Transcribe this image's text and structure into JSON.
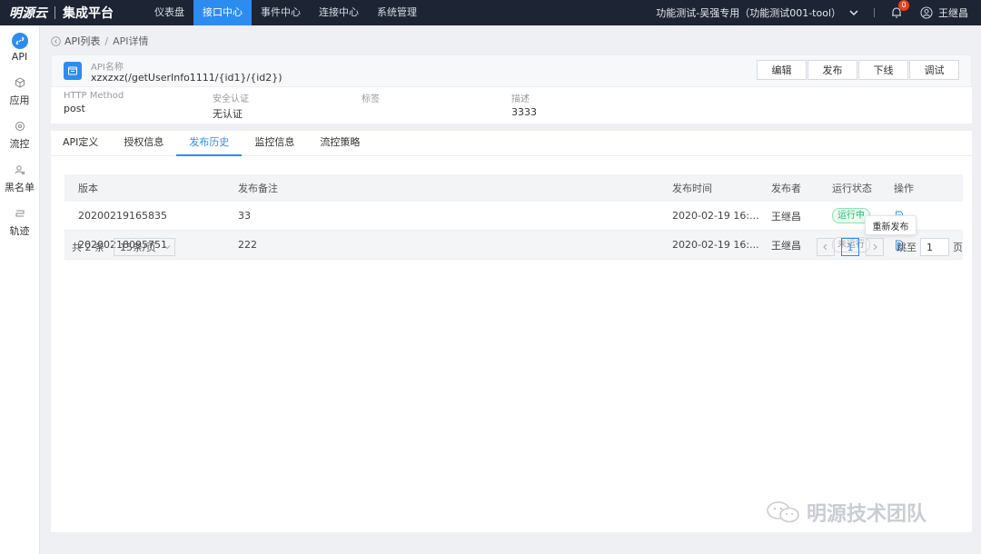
{
  "brand": {
    "logo": "明源云",
    "platform": "集成平台"
  },
  "nav": [
    {
      "label": "仪表盘",
      "active": false
    },
    {
      "label": "接口中心",
      "active": true
    },
    {
      "label": "事件中心",
      "active": false
    },
    {
      "label": "连接中心",
      "active": false
    },
    {
      "label": "系统管理",
      "active": false
    }
  ],
  "top_right": {
    "env": "功能测试-吴强专用（功能测试001-tool）",
    "badge": "0",
    "user": "王继昌"
  },
  "sidebar": [
    {
      "label": "API",
      "icon": "link-icon",
      "active": true
    },
    {
      "label": "应用",
      "icon": "cube-icon",
      "active": false
    },
    {
      "label": "流控",
      "icon": "flow-icon",
      "active": false
    },
    {
      "label": "黑名单",
      "icon": "blacklist-icon",
      "active": false
    },
    {
      "label": "轨迹",
      "icon": "trace-icon",
      "active": false
    }
  ],
  "breadcrumb": {
    "parent": "API列表",
    "separator": "/",
    "current": "API详情"
  },
  "api": {
    "name_label": "API名称",
    "name_value": "xzxzxz(/getUserInfo1111/{id1}/{id2})"
  },
  "actions": {
    "edit": "编辑",
    "publish": "发布",
    "offline": "下线",
    "debug": "调试"
  },
  "meta": {
    "method_label": "HTTP Method",
    "method_value": "post",
    "auth_label": "安全认证",
    "auth_value": "无认证",
    "tag_label": "标签",
    "tag_value": "",
    "desc_label": "描述",
    "desc_value": "3333"
  },
  "tabs": [
    {
      "label": "API定义",
      "active": false
    },
    {
      "label": "授权信息",
      "active": false
    },
    {
      "label": "发布历史",
      "active": true
    },
    {
      "label": "监控信息",
      "active": false
    },
    {
      "label": "流控策略",
      "active": false
    }
  ],
  "table": {
    "headers": {
      "version": "版本",
      "note": "发布备注",
      "time": "发布时间",
      "publisher": "发布者",
      "status": "运行状态",
      "op": "操作"
    },
    "rows": [
      {
        "version": "20200219165835",
        "note": "33",
        "time": "2020-02-19 16:...",
        "publisher": "王继昌",
        "status": "运行中",
        "status_type": "running"
      },
      {
        "version": "20200218095751",
        "note": "222",
        "time": "2020-02-19 16:...",
        "publisher": "王继昌",
        "status": "未运行",
        "status_type": "stopped"
      }
    ]
  },
  "tooltip": "重新发布",
  "pager": {
    "total": "共 2 条",
    "page_size": "15条/页",
    "current": "1",
    "jump_label": "跳至",
    "jump_value": "1",
    "page_word": "页"
  },
  "watermark": "明源技术团队",
  "colors": {
    "accent": "#2d8cf0",
    "topbar": "#1d2433",
    "running": "#19be6b"
  }
}
